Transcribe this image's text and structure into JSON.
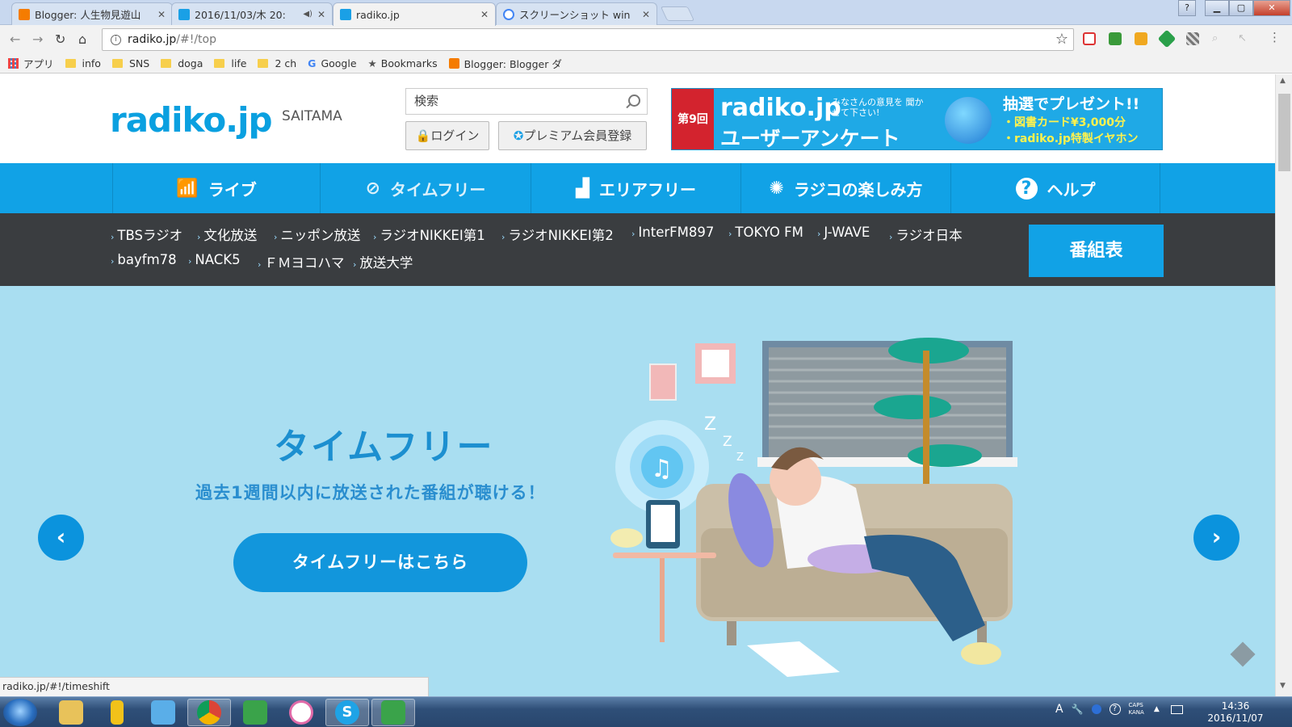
{
  "browser": {
    "tabs": [
      {
        "title": "Blogger: 人生物見遊山",
        "favicon_color": "#f57c00"
      },
      {
        "title": "2016/11/03/木 20:",
        "favicon_color": "#1aa0e6",
        "audio": "◀)"
      },
      {
        "title": "radiko.jp",
        "favicon_color": "#1aa0e6",
        "active": true
      },
      {
        "title": "スクリーンショット win",
        "favicon_color": "#4285f4"
      }
    ],
    "url_host": "radiko.jp",
    "url_path": "/#!/top",
    "window_help": "?",
    "bookmarks": [
      {
        "label": "アプリ",
        "type": "apps"
      },
      {
        "label": "info",
        "type": "folder"
      },
      {
        "label": "SNS",
        "type": "folder"
      },
      {
        "label": "doga",
        "type": "folder"
      },
      {
        "label": "life",
        "type": "folder"
      },
      {
        "label": "2 ch",
        "type": "folder"
      },
      {
        "label": "Google",
        "type": "google"
      },
      {
        "label": "Bookmarks",
        "type": "star"
      },
      {
        "label": "Blogger: Blogger ダ",
        "type": "blogger"
      }
    ],
    "status_url": "radiko.jp/#!/timeshift"
  },
  "site": {
    "logo": "radiko.jp",
    "region": "SAITAMA",
    "search_placeholder": "検索",
    "login_label": "ログイン",
    "premium_label": "プレミアム会員登録",
    "banner": {
      "badge": "第9回",
      "brand": "radiko.jp",
      "brand_sub": "みなさんの意見を 聞かせて下さい!",
      "title": "ユーザーアンケート",
      "prize_title": "抽選でプレゼント!!",
      "prize_1": "・図書カード¥3,000分",
      "prize_2": "・radiko.jp特製イヤホン"
    },
    "nav": [
      {
        "label": "ライブ",
        "icon": "wifi-icon",
        "glyph": "📶"
      },
      {
        "label": "タイムフリー",
        "icon": "clock-check-icon",
        "glyph": "⊘"
      },
      {
        "label": "エリアフリー",
        "icon": "area-icon",
        "glyph": "▟"
      },
      {
        "label": "ラジコの楽しみ方",
        "icon": "lightbulb-icon",
        "glyph": "✺"
      },
      {
        "label": "ヘルプ",
        "icon": "help-icon",
        "glyph": "?"
      }
    ],
    "stations_row1": [
      "TBSラジオ",
      "文化放送",
      "ニッポン放送",
      "ラジオNIKKEI第1",
      "ラジオNIKKEI第2",
      "InterFM897",
      "TOKYO FM",
      "J-WAVE",
      "ラジオ日本"
    ],
    "stations_row2": [
      "bayfm78",
      "NACK5",
      "ＦＭヨコハマ",
      "放送大学"
    ],
    "schedule_label": "番組表",
    "hero": {
      "title": "タイムフリー",
      "subtitle": "過去1週間以内に放送された番組が聴ける！",
      "cta": "タイムフリーはこちら",
      "prev": "‹",
      "next": "›",
      "note_glyph": "♫"
    }
  },
  "taskbar": {
    "apps": [
      {
        "name": "explorer",
        "color": "#e8c25a"
      },
      {
        "name": "sticky",
        "color": "#f2c21a"
      },
      {
        "name": "radiko",
        "color": "#5aaee8"
      },
      {
        "name": "chrome",
        "color": "#3c8ae6",
        "active": true
      },
      {
        "name": "evernote",
        "color": "#3aa34a"
      },
      {
        "name": "itunes",
        "color": "#e06aa8"
      },
      {
        "name": "skype",
        "color": "#1fa3e6"
      },
      {
        "name": "evernote2",
        "color": "#3aa34a",
        "active": true
      }
    ],
    "tray_ime": "A",
    "tray_caps": "CAPS",
    "tray_kana": "KANA",
    "time": "14:36",
    "date": "2016/11/07"
  }
}
